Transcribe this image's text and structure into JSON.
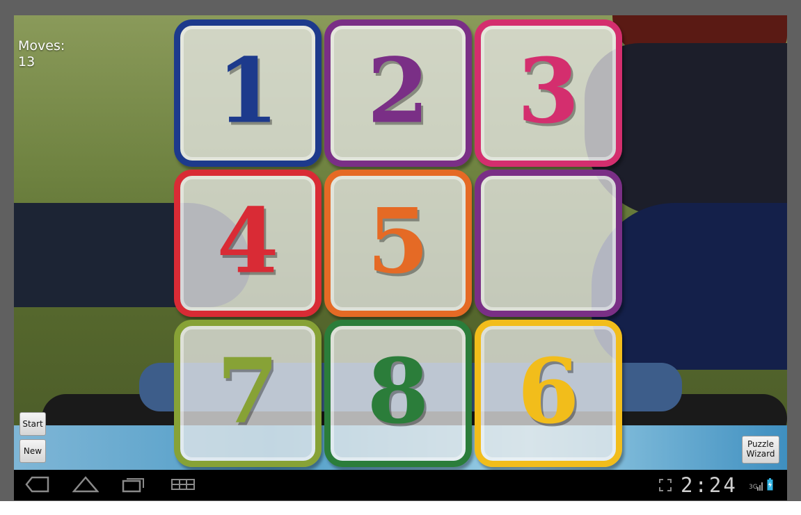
{
  "game": {
    "moves_label": "Moves:",
    "moves_value": "13"
  },
  "board": {
    "rows": 3,
    "cols": 3,
    "tiles": [
      {
        "label": "1",
        "color": "#1d3a8c"
      },
      {
        "label": "2",
        "color": "#7a2f86"
      },
      {
        "label": "3",
        "color": "#d42e6e"
      },
      {
        "label": "4",
        "color": "#d92b35"
      },
      {
        "label": "5",
        "color": "#e56a25"
      },
      {
        "label": "",
        "color": "#7a2f86"
      },
      {
        "label": "7",
        "color": "#87a236"
      },
      {
        "label": "8",
        "color": "#2b7d3a"
      },
      {
        "label": "6",
        "color": "#f2bd1b"
      }
    ]
  },
  "controls": {
    "start_label": "Start",
    "new_label": "New",
    "wizard_label_line1": "Puzzle",
    "wizard_label_line2": "Wizard"
  },
  "system_bar": {
    "time": "2:24",
    "network": "3G",
    "icons": [
      "back-icon",
      "home-icon",
      "recent-apps-icon",
      "menu-grid-icon",
      "fullscreen-icon",
      "signal-icon",
      "battery-icon"
    ]
  }
}
